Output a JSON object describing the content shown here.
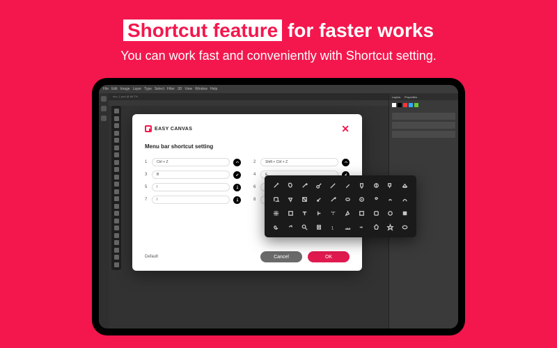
{
  "hero": {
    "highlight": "Shortcut feature",
    "rest": " for faster works",
    "subtitle": "You can work fast and conveniently with Shortcut setting."
  },
  "app": {
    "menu": [
      "File",
      "Edit",
      "Image",
      "Layer",
      "Type",
      "Select",
      "Filter",
      "3D",
      "View",
      "Window",
      "Help"
    ],
    "doc_tab": "doc_1.psd @ 66.7%",
    "right_tabs": [
      "Layers",
      "Properties"
    ]
  },
  "modal": {
    "brand": "EASY CANVAS",
    "title": "Menu bar shortcut setting",
    "shortcuts": [
      {
        "num": "1",
        "value": "Ctrl + Z"
      },
      {
        "num": "2",
        "value": "Shift + Ctrl + Z"
      },
      {
        "num": "3",
        "value": "B"
      },
      {
        "num": "4",
        "value": "E"
      },
      {
        "num": "5",
        "value": "I"
      },
      {
        "num": "6",
        "value": ""
      },
      {
        "num": "7",
        "value": "I"
      },
      {
        "num": "8",
        "value": ""
      }
    ],
    "default_label": "Default",
    "cancel_label": "Cancel",
    "ok_label": "OK"
  },
  "palette": {
    "icons": [
      "wand-icon",
      "lasso-icon",
      "brush-icon",
      "healing-icon",
      "pencil-icon",
      "pen-icon",
      "bucket-icon",
      "blur-icon",
      "stamp-icon",
      "eraser-icon",
      "crop-icon",
      "slice-icon",
      "gradient-icon",
      "eyedropper-icon",
      "brushalt-icon",
      "sponge-icon",
      "spot-icon",
      "dodge-icon",
      "burn-icon",
      "smudge-icon",
      "move-icon",
      "artboard-icon",
      "type-icon",
      "typevert-icon",
      "typemask-icon",
      "path-icon",
      "rect-icon",
      "roundrect-icon",
      "ellipse-icon",
      "rectfilled-icon",
      "hand-icon",
      "rotate-icon",
      "zoom-icon",
      "note-icon",
      "count-icon",
      "ruler-icon",
      "line-icon",
      "poly-icon",
      "custom-icon",
      "ellipsealt-icon"
    ]
  }
}
